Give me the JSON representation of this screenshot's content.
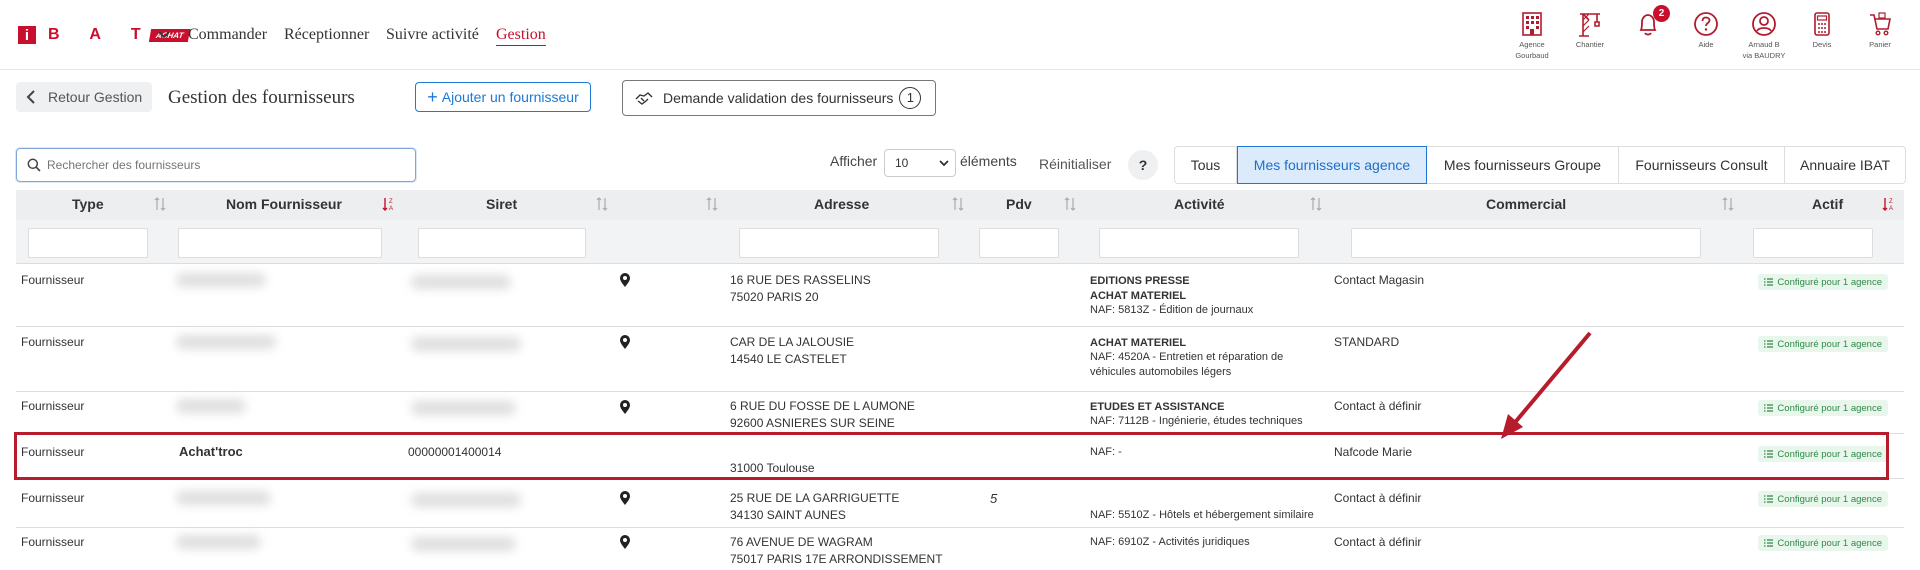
{
  "nav": {
    "logo_letters": "B A T",
    "logo_achat": "ACHAT",
    "items": [
      "Commander",
      "Réceptionner",
      "Suivre activité",
      "Gestion"
    ]
  },
  "top_icons": [
    {
      "name": "agency-icon",
      "label1": "Agence",
      "label2": "Gourbaud"
    },
    {
      "name": "chantier-icon",
      "label1": "Chantier",
      "label2": ""
    },
    {
      "name": "bell-icon",
      "label1": "",
      "label2": "",
      "badge": "2"
    },
    {
      "name": "help-icon",
      "label1": "Aide",
      "label2": ""
    },
    {
      "name": "user-icon",
      "label1": "Arnaud B",
      "label2": "via BAUDRY"
    },
    {
      "name": "calculator-icon",
      "label1": "Devis",
      "label2": ""
    },
    {
      "name": "cart-icon",
      "label1": "Panier",
      "label2": ""
    }
  ],
  "header": {
    "back_label": "Retour Gestion",
    "title": "Gestion des fournisseurs",
    "add_label": "Ajouter un fournisseur",
    "validate_label": "Demande validation des fournisseurs",
    "validate_count": "1"
  },
  "filters": {
    "search_placeholder": "Rechercher des fournisseurs",
    "afficher": "Afficher",
    "page_size": "10",
    "elements": "éléments",
    "reset": "Réinitialiser",
    "help": "?",
    "segments": [
      "Tous",
      "Mes fournisseurs agence",
      "Mes fournisseurs Groupe",
      "Fournisseurs Consult",
      "Annuaire IBAT"
    ],
    "active_segment": "Mes fournisseurs agence"
  },
  "table": {
    "columns": [
      "Type",
      "Nom Fournisseur",
      "Siret",
      "",
      "Adresse",
      "Pdv",
      "Activité",
      "Commercial",
      "Actif"
    ],
    "rows": [
      {
        "type": "Fournisseur",
        "name": "",
        "siret": "",
        "addr1": "16 RUE DES RASSELINS",
        "addr2": "75020 PARIS 20",
        "pdv": "",
        "act1": "EDITIONS PRESSE",
        "act2": "ACHAT MATERIEL",
        "act3_code": "NAF: 5813Z",
        "act3_text": " - Édition de journaux",
        "act4": "",
        "commercial": "Contact Magasin",
        "actif": "Configuré pour 1 agence"
      },
      {
        "type": "Fournisseur",
        "name": "",
        "siret": "",
        "addr1": "CAR DE LA JALOUSIE",
        "addr2": "14540 LE CASTELET",
        "pdv": "",
        "act1": "ACHAT MATERIEL",
        "act2": "",
        "act3_code": "NAF: 4520A",
        "act3_text": " - Entretien et réparation de",
        "act4": "véhicules automobiles légers",
        "commercial": "STANDARD",
        "actif": "Configuré pour 1 agence"
      },
      {
        "type": "Fournisseur",
        "name": "",
        "siret": "",
        "addr1": "6 RUE DU FOSSE DE L AUMONE",
        "addr2": "92600 ASNIERES SUR SEINE",
        "pdv": "",
        "act1": "ETUDES ET ASSISTANCE",
        "act2": "",
        "act3_code": "NAF: 7112B",
        "act3_text": " - Ingénierie, études techniques",
        "act4": "",
        "commercial": "Contact à définir",
        "actif": "Configuré pour 1 agence"
      },
      {
        "type": "Fournisseur",
        "name": "Achat'troc",
        "siret": "00000001400014",
        "addr1": "",
        "addr2": "31000 Toulouse",
        "pdv": "",
        "act1": "",
        "act2": "",
        "act3_code": "NAF: -",
        "act3_text": "",
        "act4": "",
        "commercial": "Nafcode Marie",
        "actif": "Configuré pour 1 agence"
      },
      {
        "type": "Fournisseur",
        "name": "",
        "siret": "",
        "addr1": "25 RUE DE LA GARRIGUETTE",
        "addr2": "34130 SAINT AUNES",
        "pdv": "5",
        "act1": "",
        "act2": "",
        "act3_code": "NAF: 5510Z",
        "act3_text": " - Hôtels et hébergement similaire",
        "act4": "",
        "commercial": "Contact à définir",
        "actif": "Configuré pour 1 agence"
      },
      {
        "type": "Fournisseur",
        "name": "",
        "siret": "",
        "addr1": "76 AVENUE DE WAGRAM",
        "addr2": "75017 PARIS 17E ARRONDISSEMENT",
        "pdv": "",
        "act1": "",
        "act2": "",
        "act3_code": "NAF: 6910Z",
        "act3_text": " - Activités juridiques",
        "act4": "",
        "commercial": "Contact à définir",
        "actif": "Configuré pour 1 agence"
      }
    ]
  },
  "colors": {
    "brand_red": "#c8102e",
    "link_blue": "#1e78d6",
    "tag_green": "#2f8a48",
    "annotation_red": "#b71c2c"
  }
}
